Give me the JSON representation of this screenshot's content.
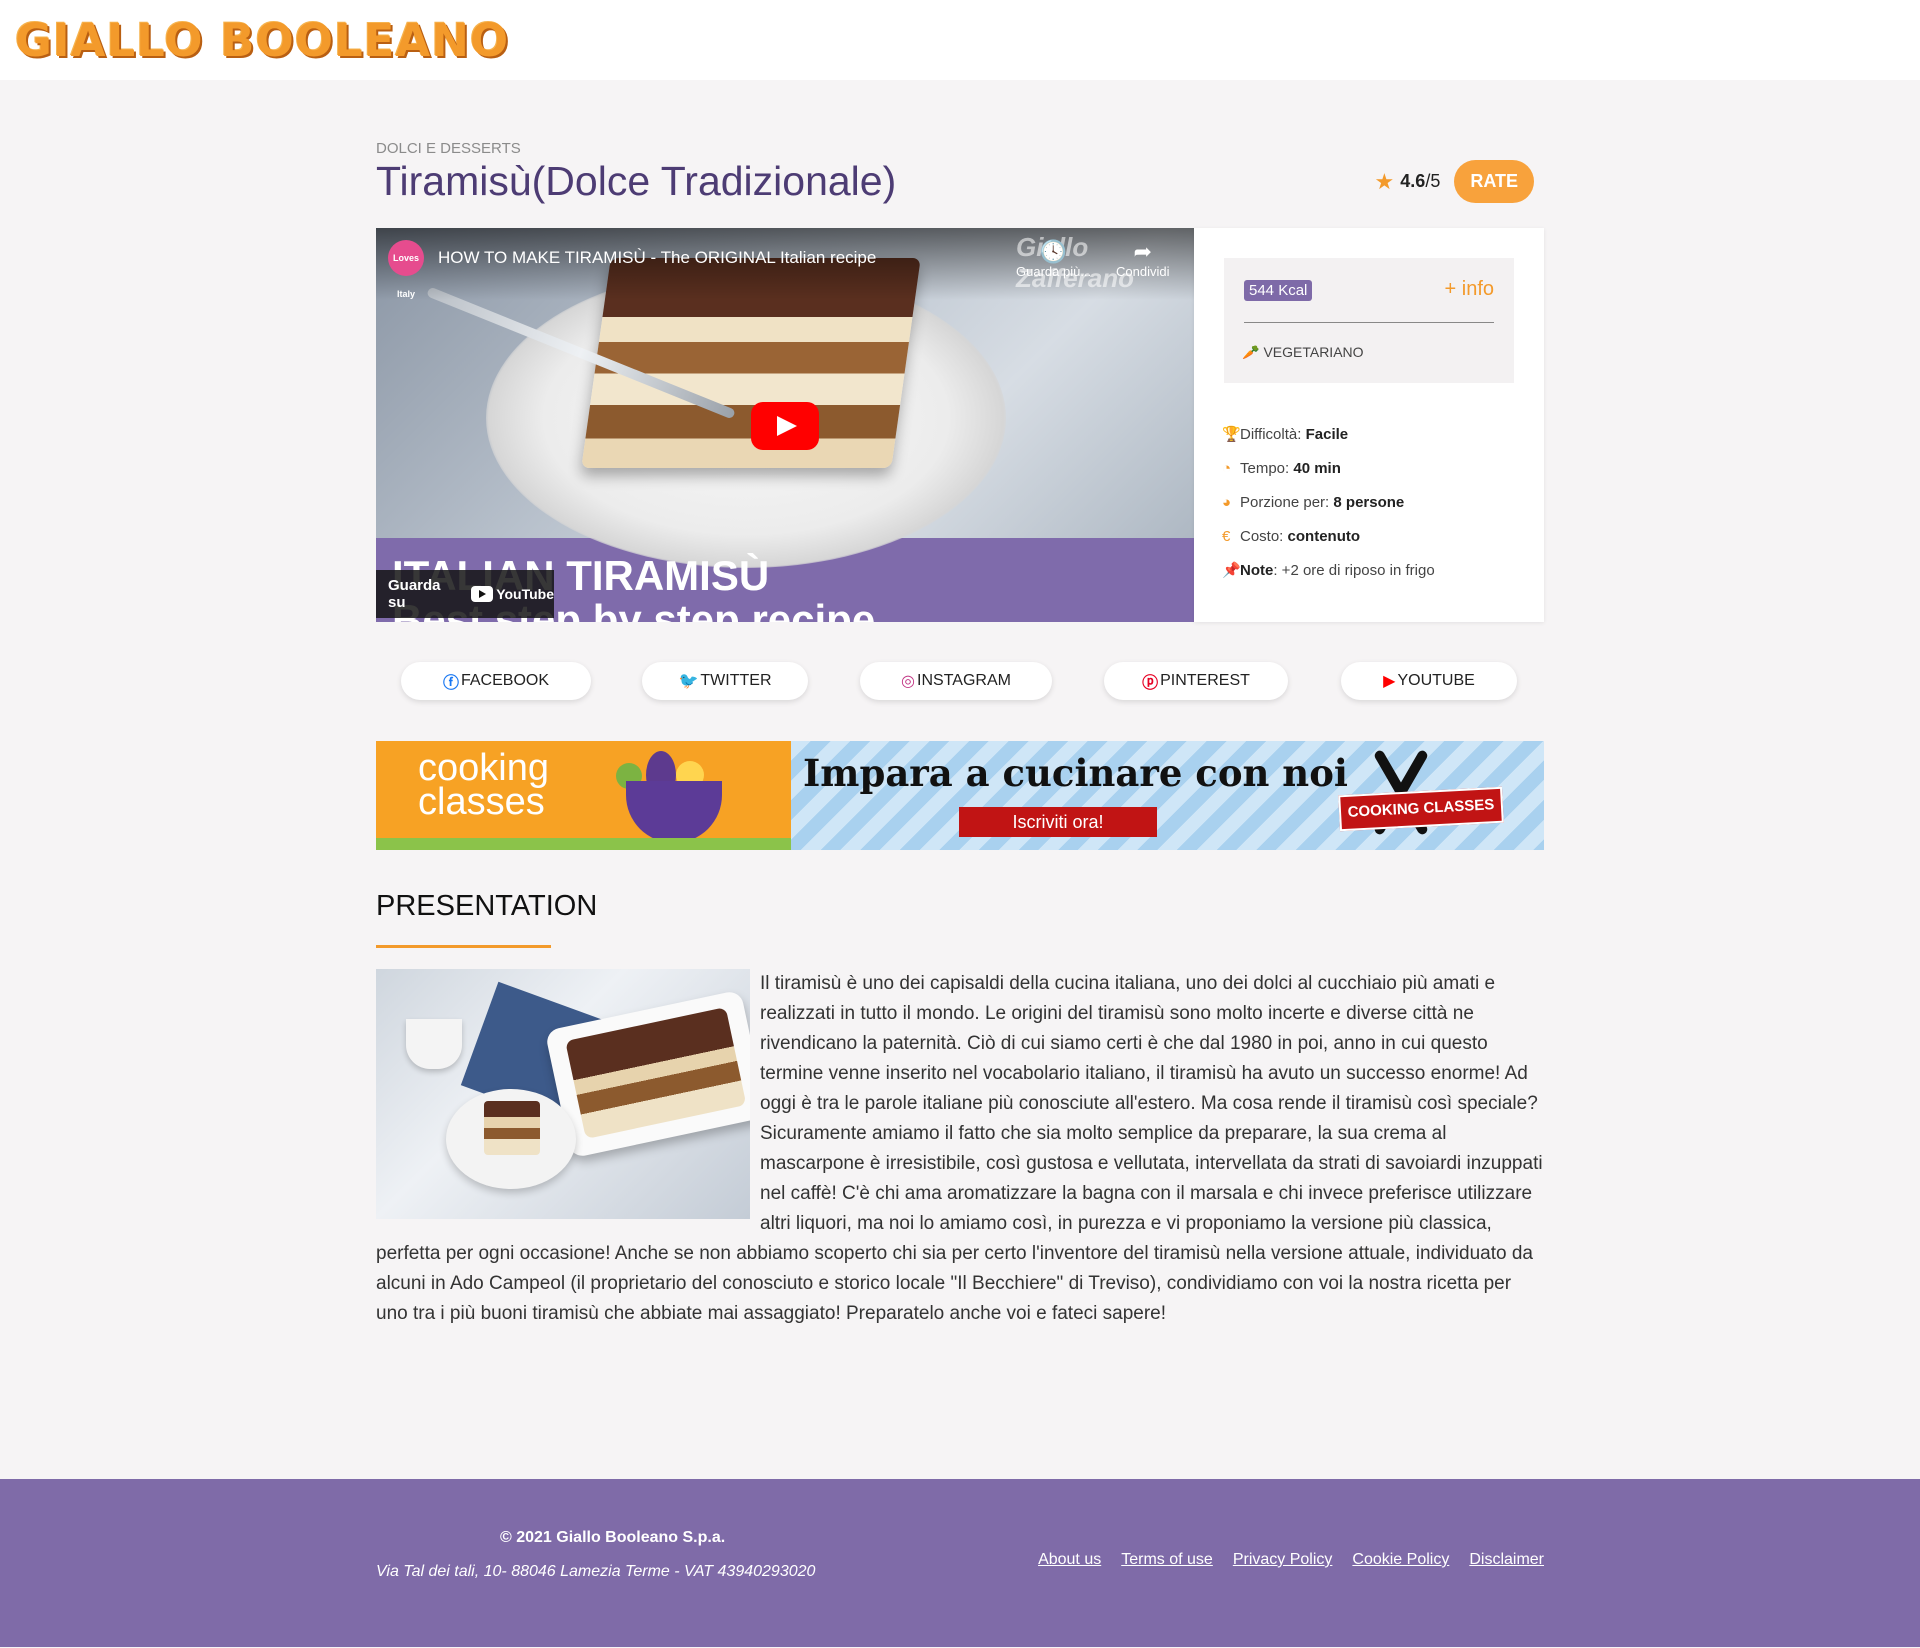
{
  "header": {
    "logo": "GIALLO BOOLEANO"
  },
  "recipe": {
    "category": "DOLCI E DESSERTS",
    "title": "Tiramisù(Dolce Tradizionale)",
    "rating_value": "4.6",
    "rating_max": "/5",
    "rate_label": "RATE"
  },
  "video": {
    "channel_badge": "Loves Italy",
    "title": "HOW TO MAKE TIRAMISÙ - The ORIGINAL Italian recipe",
    "watch_later": "Guarda più...",
    "share": "Condividi",
    "watermark": "Giallo Zafferano",
    "overlay_line1": "ITALIAN TIRAMISÙ",
    "overlay_line2": "Best step by step recipe",
    "watch_on": "Guarda su",
    "youtube": "YouTube"
  },
  "info": {
    "kcal": "544 Kcal",
    "more_info": "+ info",
    "diet": "VEGETARIANO",
    "stats": [
      {
        "label": "Difficoltà: ",
        "value": "Facile",
        "icon": "trophy-icon"
      },
      {
        "label": "Tempo: ",
        "value": "40 min",
        "icon": "clock-icon"
      },
      {
        "label": "Porzione per: ",
        "value": "8 persone",
        "icon": "pie-icon"
      },
      {
        "label": "Costo: ",
        "value": "contenuto",
        "icon": "euro-icon"
      }
    ],
    "note_label": "Note",
    "note_text": ": +2 ore di riposo in frigo"
  },
  "socials": [
    {
      "label": "FACEBOOK",
      "color": "#1877f2"
    },
    {
      "label": "TWITTER",
      "color": "#1da1f2"
    },
    {
      "label": "INSTAGRAM",
      "color": "#c13584"
    },
    {
      "label": "PINTEREST",
      "color": "#e60023"
    },
    {
      "label": "YOUTUBE",
      "color": "#ff0000"
    }
  ],
  "banner": {
    "cooking": "cooking",
    "classes": "classes",
    "headline": "Impara a cucinare con noi",
    "cta": "Iscriviti ora!",
    "ribbon": "COOKING CLASSES"
  },
  "presentation": {
    "heading": "PRESENTATION",
    "text": "Il tiramisù è uno dei capisaldi della cucina italiana, uno dei dolci al cucchiaio più amati e realizzati in tutto il mondo. Le origini del tiramisù sono molto incerte e diverse città ne rivendicano la paternità. Ciò di cui siamo certi è che dal 1980 in poi, anno in cui questo termine venne inserito nel vocabolario italiano, il tiramisù ha avuto un successo enorme! Ad oggi è tra le parole italiane più conosciute all'estero. Ma cosa rende il tiramisù così speciale? Sicuramente amiamo il fatto che sia molto semplice da preparare, la sua crema al mascarpone è irresistibile, così gustosa e vellutata, intervellata da strati di savoiardi inzuppati nel caffè! C'è chi ama aromatizzare la bagna con il marsala e chi invece preferisce utilizzare altri liquori, ma noi lo amiamo così, in purezza e vi proponiamo la versione più classica, perfetta per ogni occasione! Anche se non abbiamo scoperto chi sia per certo l'inventore del tiramisù nella versione attuale, individuato da alcuni in Ado Campeol (il proprietario del conosciuto e storico locale \"Il Becchiere\" di Treviso), condividiamo con voi la nostra ricetta per uno tra i più buoni tiramisù che abbiate mai assaggiato! Preparatelo anche voi e fateci sapere!"
  },
  "footer": {
    "copyright": "© 2021 Giallo Booleano S.p.a.",
    "address": "Via Tal dei tali, 10- 88046 Lamezia Terme - VAT 43940293020",
    "links": [
      "About us",
      "Terms of use",
      "Privacy Policy",
      "Cookie Policy",
      "Disclaimer"
    ]
  },
  "colors": {
    "accent_orange": "#f39a2b",
    "brand_purple": "#7f6ba8",
    "title_purple": "#4d3c74"
  }
}
